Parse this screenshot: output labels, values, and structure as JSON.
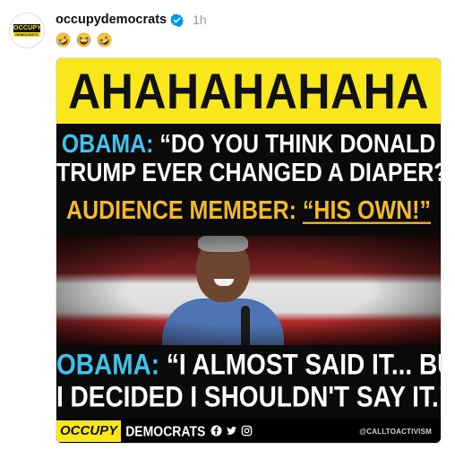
{
  "post": {
    "username": "occupydemocrats",
    "time": "1h",
    "reactions": [
      "rolling-on-floor-laughing",
      "grinning-squinting",
      "rolling-on-floor-laughing"
    ]
  },
  "avatar": {
    "top": "OCCUPY",
    "bottom": "DEMOCRATS"
  },
  "meme": {
    "banner": "AHAHAHAHAHA",
    "line1_speaker": "OBAMA:",
    "line1_quote": "“DO YOU THINK DONALD",
    "line2": "TRUMP EVER CHANGED A DIAPER?”",
    "line3_speaker": "AUDIENCE MEMBER:",
    "line3_quote": "“HIS OWN!”",
    "line4_speaker": "OBAMA:",
    "line4_quote": "“I ALMOST SAID IT... BUT",
    "line5": "I DECIDED I SHOULDN'T SAY IT.”",
    "footer_brand_box": "OCCUPY",
    "footer_brand_rest": "DEMOCRATS",
    "footer_handle": "@CALLTOACTIVISM"
  },
  "colors": {
    "banner_yellow": "#f9e71c",
    "speaker_blue": "#3ec2ee",
    "audience_gold": "#f2b92c",
    "verified_blue": "#0095f6"
  },
  "icons": [
    "verified-badge-icon",
    "facebook-icon",
    "twitter-icon",
    "instagram-icon"
  ]
}
